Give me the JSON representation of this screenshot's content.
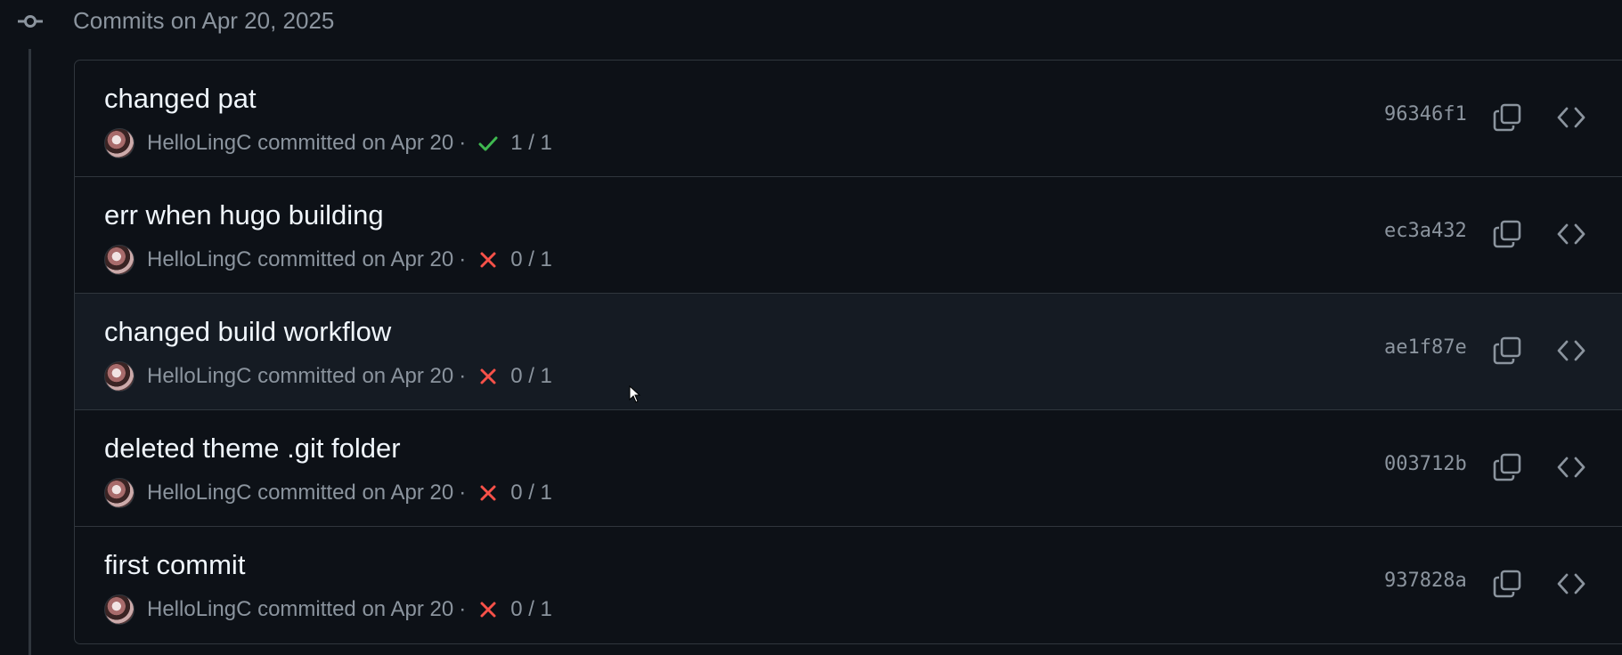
{
  "group": {
    "title": "Commits on Apr 20, 2025"
  },
  "commits": [
    {
      "message": "changed pat",
      "author": "HelloLingC",
      "committed_text": "committed on Apr 20",
      "separator": "·",
      "status": "success",
      "checks": "1 / 1",
      "sha": "96346f1"
    },
    {
      "message": "err when hugo building",
      "author": "HelloLingC",
      "committed_text": "committed on Apr 20",
      "separator": "·",
      "status": "failure",
      "checks": "0 / 1",
      "sha": "ec3a432"
    },
    {
      "message": "changed build workflow",
      "author": "HelloLingC",
      "committed_text": "committed on Apr 20",
      "separator": "·",
      "status": "failure",
      "checks": "0 / 1",
      "sha": "ae1f87e"
    },
    {
      "message": "deleted theme .git folder",
      "author": "HelloLingC",
      "committed_text": "committed on Apr 20",
      "separator": "·",
      "status": "failure",
      "checks": "0 / 1",
      "sha": "003712b"
    },
    {
      "message": "first commit",
      "author": "HelloLingC",
      "committed_text": "committed on Apr 20",
      "separator": "·",
      "status": "failure",
      "checks": "0 / 1",
      "sha": "937828a"
    }
  ],
  "colors": {
    "success": "#3fb950",
    "failure": "#f85149",
    "muted": "#8b949e",
    "border": "#30363d"
  },
  "icons": {
    "group": "git-commit-icon",
    "copy": "copy-icon",
    "browse": "code-icon",
    "success": "check-icon",
    "failure": "x-icon"
  }
}
